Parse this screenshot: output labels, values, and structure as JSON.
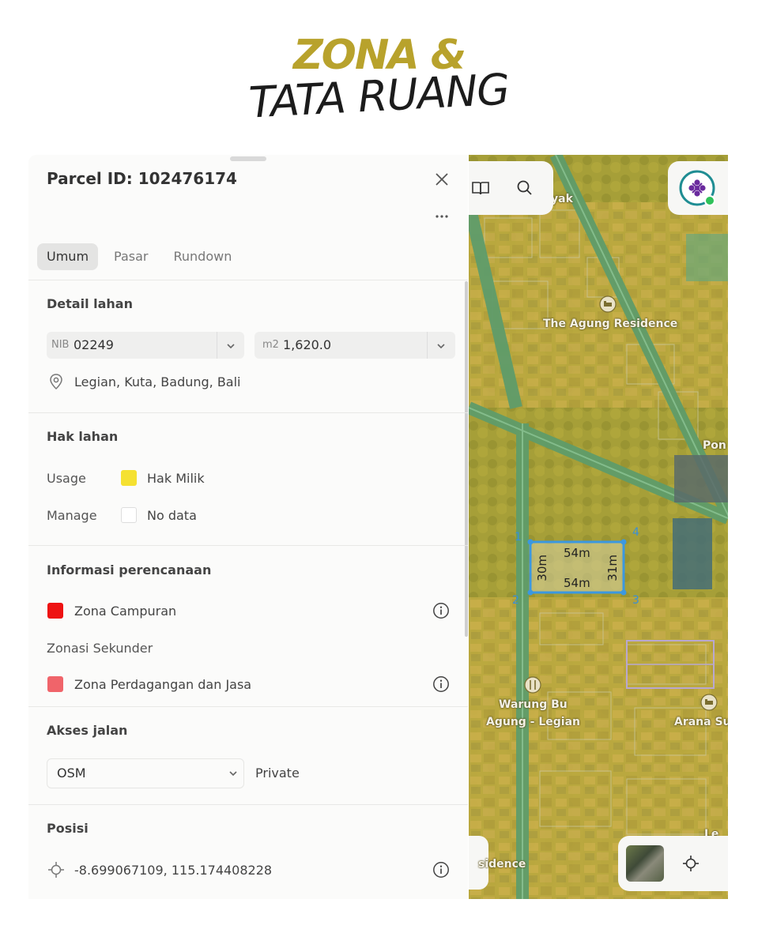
{
  "header": {
    "line1": "ZONA &",
    "line2": "TATA RUANG"
  },
  "panel": {
    "title": "Parcel ID: 102476174",
    "close_label": "×",
    "more_label": "•••",
    "tabs": [
      {
        "label": "Umum",
        "active": true
      },
      {
        "label": "Pasar"
      },
      {
        "label": "Rundown"
      }
    ],
    "detail": {
      "title": "Detail lahan",
      "nib_prefix": "NIB",
      "nib_value": "02249",
      "area_prefix": "m2",
      "area_value": "1,620.0",
      "address": "Legian, Kuta, Badung, Bali"
    },
    "hak": {
      "title": "Hak lahan",
      "usage_label": "Usage",
      "usage_value": "Hak Milik",
      "usage_color": "#f5e131",
      "manage_label": "Manage",
      "manage_value": "No data"
    },
    "perencanaan": {
      "title": "Informasi perencanaan",
      "primary_zone": "Zona Campuran",
      "primary_color": "#ee1212",
      "secondary_label": "Zonasi Sekunder",
      "secondary_zone": "Zona Perdagangan dan Jasa",
      "secondary_color": "#f0646a"
    },
    "akses": {
      "title": "Akses jalan",
      "source": "OSM",
      "type": "Private"
    },
    "posisi": {
      "title": "Posisi",
      "coords": "-8.699067109, 115.174408228"
    }
  },
  "map": {
    "labels": {
      "residence": "The Agung Residence",
      "warung_1": "Warung Bu",
      "warung_2": "Agung - Legian",
      "arana": "Arana Su",
      "yak": "yak",
      "pon": "Pon",
      "sidence": "sidence",
      "le": "Le"
    },
    "dims": {
      "top": "54m",
      "bottom": "54m",
      "left": "30m",
      "right": "31m"
    },
    "points": {
      "p1": "1",
      "p2": "2",
      "p3": "3",
      "p4": "4"
    },
    "highlight_color": "#3b98e0"
  }
}
